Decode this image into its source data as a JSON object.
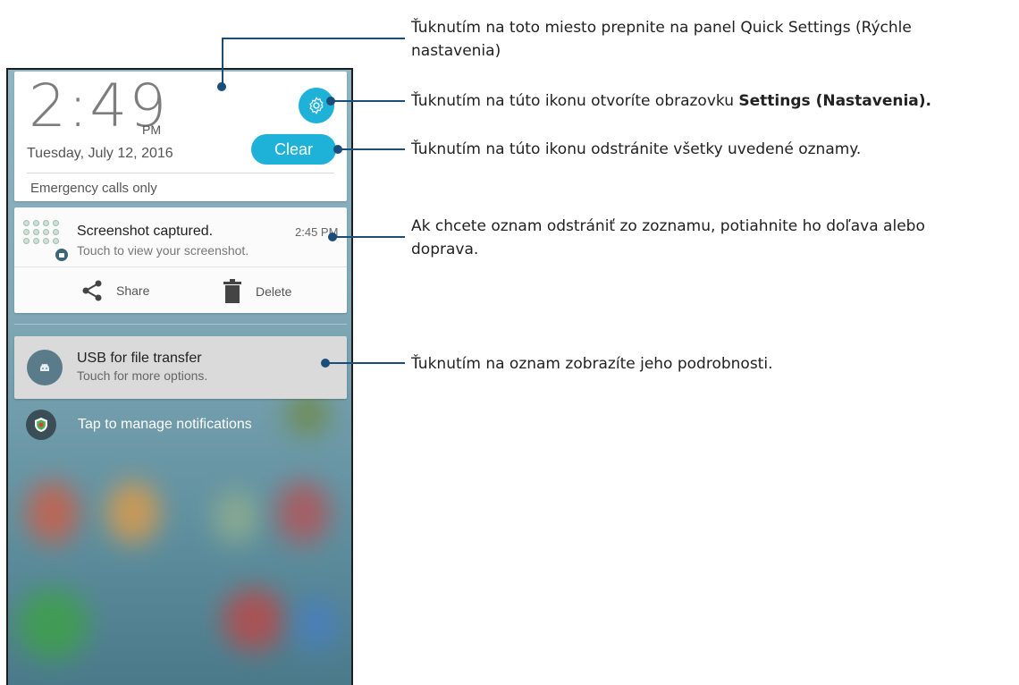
{
  "header": {
    "time": "2:49",
    "ampm": "PM",
    "date": "Tuesday, July 12, 2016",
    "clear_label": "Clear",
    "emergency": "Emergency calls only",
    "settings_icon": "gear-icon"
  },
  "screenshot_notification": {
    "title": "Screenshot captured.",
    "time": "2:45 PM",
    "subtitle": "Touch to view your screenshot.",
    "share_label": "Share",
    "delete_label": "Delete"
  },
  "usb_notification": {
    "title": "USB for file transfer",
    "subtitle": "Touch for more options."
  },
  "manage": {
    "label": "Tap to manage notifications"
  },
  "callouts": {
    "quick_settings": "Ťuknutím na toto miesto prepnite na panel Quick Settings (Rýchle nastavenia)",
    "settings_prefix": "Ťuknutím na túto ikonu otvoríte obrazovku ",
    "settings_bold": "Settings (Nastavenia).",
    "clear": "Ťuknutím na túto ikonu odstránite všetky uvedené oznamy.",
    "swipe": "Ak chcete oznam odstrániť zo zoznamu, potiahnite ho doľava alebo doprava.",
    "details": "Ťuknutím na oznam zobrazíte jeho podrobnosti."
  },
  "colors": {
    "accent": "#1fb2d9",
    "leader": "#1a4e7a"
  }
}
